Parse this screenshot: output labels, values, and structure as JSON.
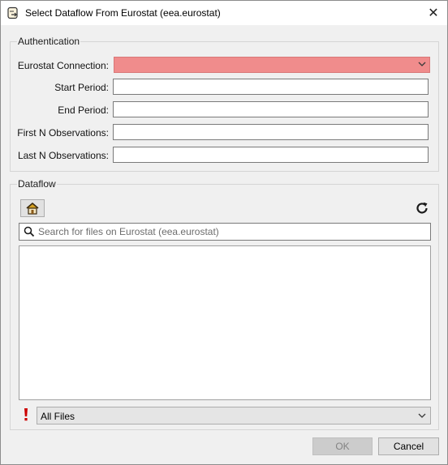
{
  "window": {
    "title": "Select Dataflow From Eurostat (eea.eurostat)",
    "close_glyph": "✕"
  },
  "authentication": {
    "group_title": "Authentication",
    "connection_label": "Eurostat Connection:",
    "connection_value": "",
    "start_period_label": "Start Period:",
    "start_period_value": "",
    "end_period_label": "End Period:",
    "end_period_value": "",
    "first_n_label": "First N Observations:",
    "first_n_value": "",
    "last_n_label": "Last N Observations:",
    "last_n_value": ""
  },
  "dataflow": {
    "group_title": "Dataflow",
    "home_icon": "home-icon",
    "refresh_icon": "refresh-icon",
    "search_placeholder": "Search for files on Eurostat (eea.eurostat)",
    "search_value": "",
    "files": [],
    "filter_value": "All Files"
  },
  "buttons": {
    "ok_label": "OK",
    "ok_enabled": false,
    "cancel_label": "Cancel"
  },
  "colors": {
    "invalid_field": "#f08c8c",
    "warning": "#cc0000",
    "home_roof": "#d4a020"
  }
}
